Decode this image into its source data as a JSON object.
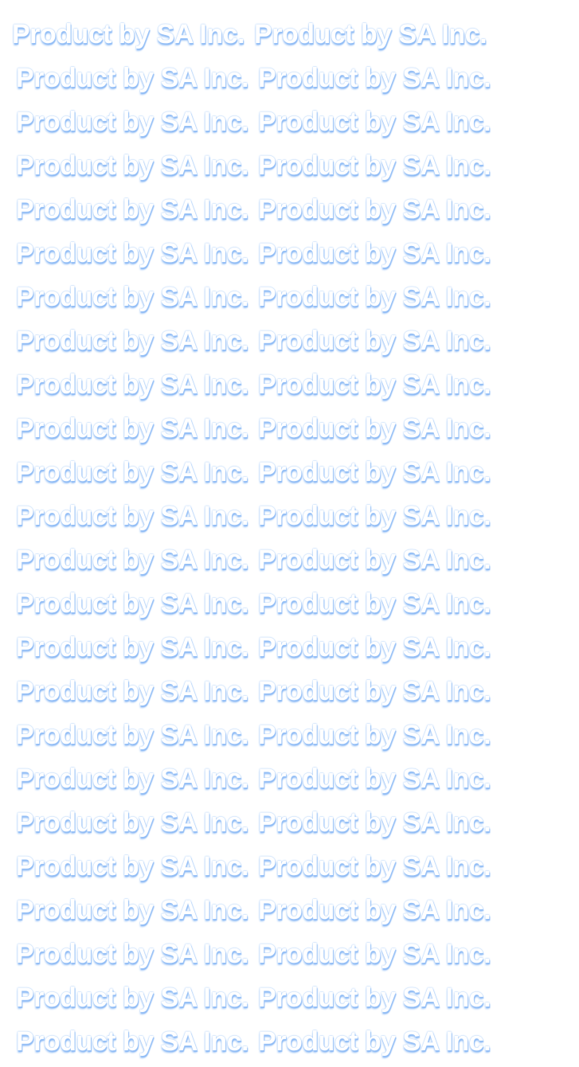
{
  "watermark": {
    "text": "Product by SA Inc.",
    "fill_color": "#ffffff",
    "shadow_color": "#8ab8f5"
  }
}
